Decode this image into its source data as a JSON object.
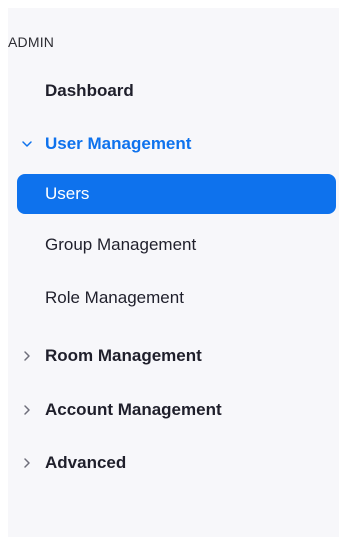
{
  "sidebar": {
    "section_title": "ADMIN",
    "items": [
      {
        "label": "Dashboard"
      },
      {
        "label": "User Management"
      },
      {
        "label": "Users"
      },
      {
        "label": "Group Management"
      },
      {
        "label": "Role Management"
      },
      {
        "label": "Room Management"
      },
      {
        "label": "Account Management"
      },
      {
        "label": "Advanced"
      }
    ]
  },
  "colors": {
    "accent": "#0e72ed",
    "sidebar_bg": "#f7f7fa",
    "text": "#1f1f2b"
  },
  "icons": {
    "expanded": "chevron-down-icon",
    "collapsed": "chevron-right-icon"
  }
}
